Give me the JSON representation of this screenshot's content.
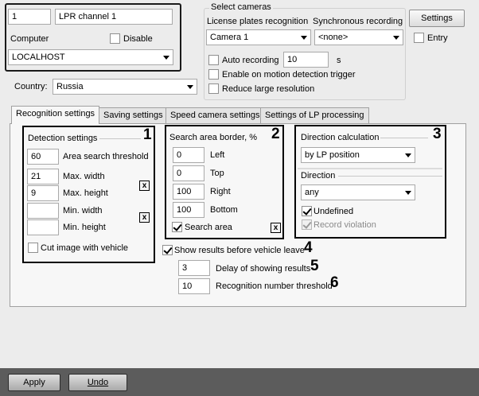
{
  "channel": {
    "id": "1",
    "name": "LPR channel 1",
    "computer_label": "Computer",
    "disable_label": "Disable",
    "computer_value": "LOCALHOST"
  },
  "country": {
    "label": "Country:",
    "value": "Russia"
  },
  "cameras": {
    "group_title": "Select cameras",
    "lpr_label": "License plates recognition",
    "sync_label": "Synchronous recording",
    "lpr_camera": "Camera 1",
    "sync_camera": "<none>",
    "settings_button": "Settings",
    "entry_label": "Entry",
    "auto_recording_label": "Auto recording",
    "auto_recording_value": "10",
    "auto_recording_unit": "s",
    "motion_trigger_label": "Enable on motion detection trigger",
    "reduce_resolution_label": "Reduce large resolution"
  },
  "tabs": [
    {
      "label": "Recognition settings"
    },
    {
      "label": "Saving settings"
    },
    {
      "label": "Speed camera settings"
    },
    {
      "label": "Settings of LP processing"
    }
  ],
  "detection": {
    "title": "Detection settings",
    "marker": "1",
    "area_threshold_value": "60",
    "area_threshold_label": "Area search threshold",
    "max_width_value": "21",
    "max_width_label": "Max. width",
    "max_height_value": "9",
    "max_height_label": "Max. height",
    "min_width_value": "",
    "min_width_label": "Min. width",
    "min_height_value": "",
    "min_height_label": "Min. height",
    "cut_image_label": "Cut image with vehicle",
    "clear_symbol": "x"
  },
  "search_area": {
    "title": "Search area border, %",
    "marker": "2",
    "left_value": "0",
    "left_label": "Left",
    "top_value": "0",
    "top_label": "Top",
    "right_value": "100",
    "right_label": "Right",
    "bottom_value": "100",
    "bottom_label": "Bottom",
    "search_area_label": "Search area",
    "clear_symbol": "x"
  },
  "direction": {
    "calc_title": "Direction calculation",
    "marker": "3",
    "calc_value": "by LP position",
    "direction_title": "Direction",
    "direction_value": "any",
    "undefined_label": "Undefined",
    "violation_label": "Record violation"
  },
  "results": {
    "show_before_leave_label": "Show results before vehicle leave",
    "marker4": "4",
    "delay_value": "3",
    "delay_label": "Delay of showing results",
    "marker5": "5",
    "threshold_value": "10",
    "threshold_label": "Recognition number threshold",
    "marker6": "6"
  },
  "footer": {
    "apply_label": "Apply",
    "undo_label": "Undo"
  }
}
